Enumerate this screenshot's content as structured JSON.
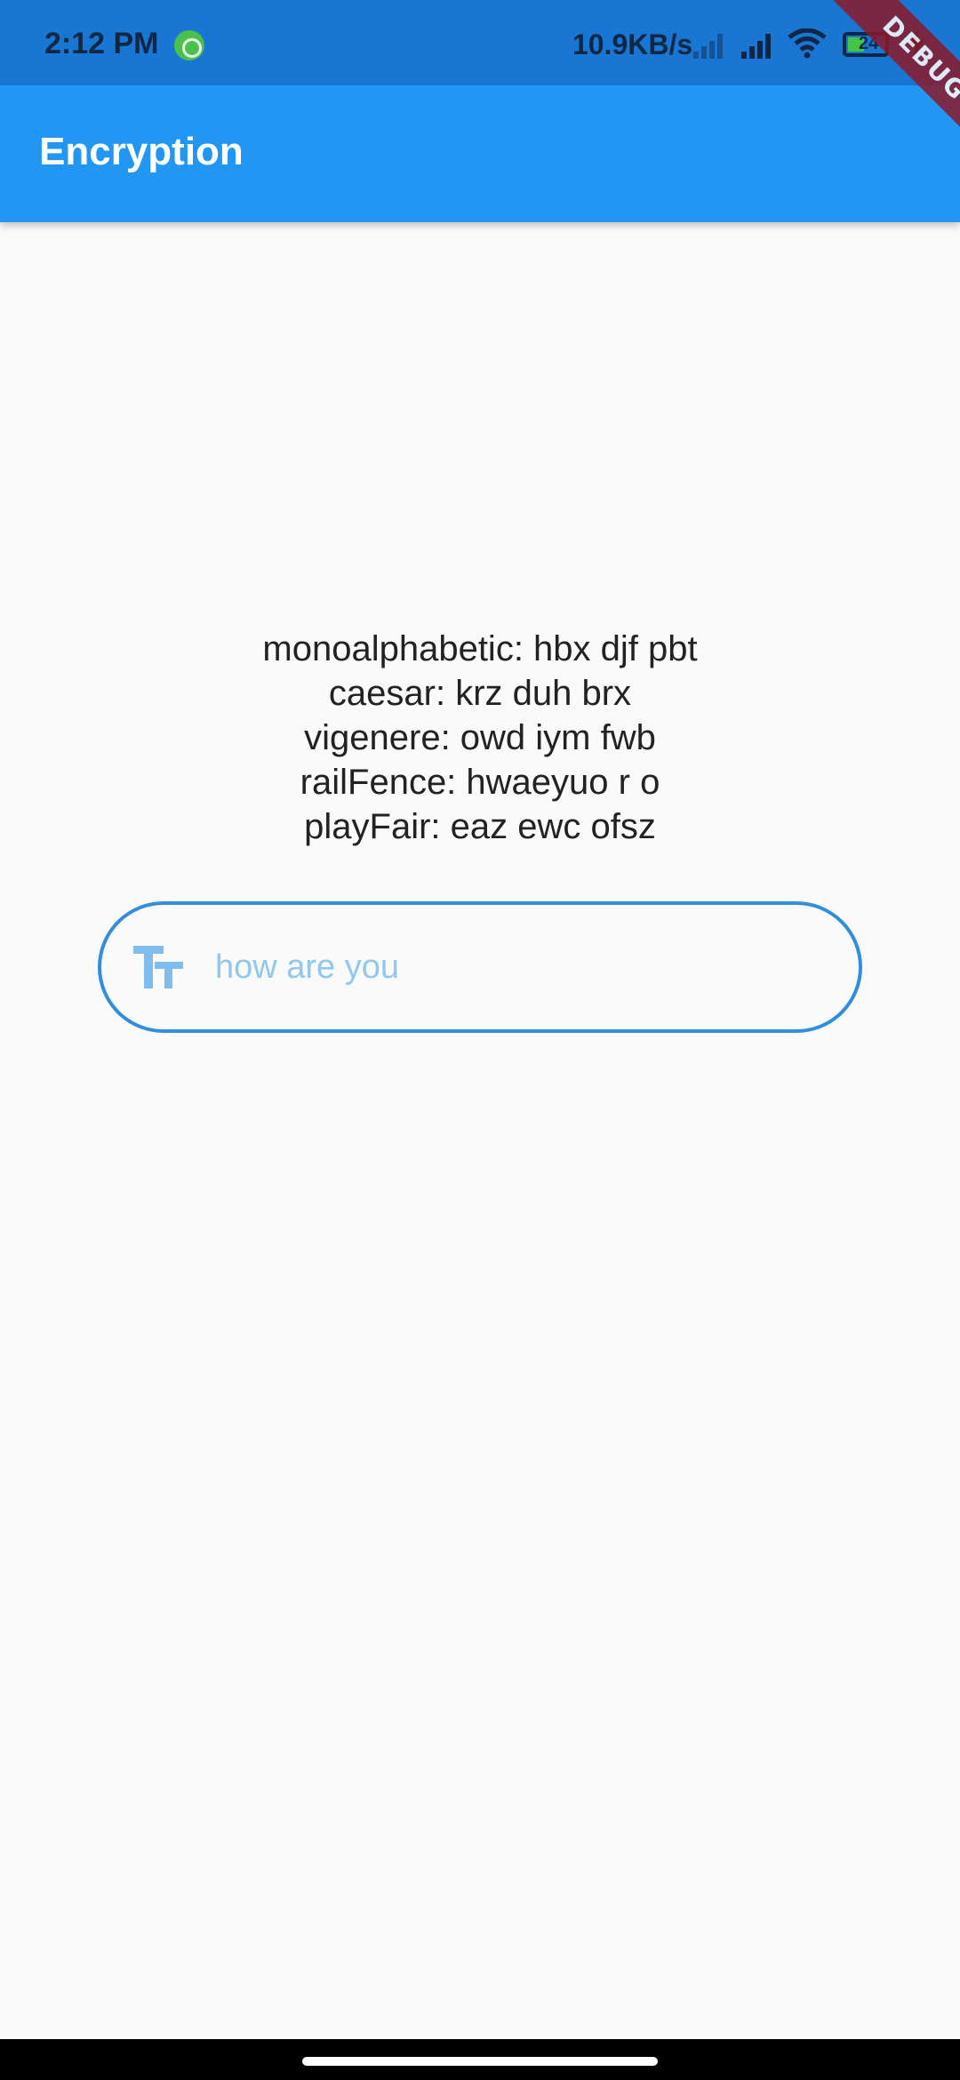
{
  "status_bar": {
    "time": "2:12 PM",
    "network_speed": "10.9KB/s",
    "battery_level": "24",
    "icons": [
      "app-notification-icon",
      "signal-icon",
      "signal-icon",
      "wifi-icon",
      "battery-icon",
      "charging-icon"
    ]
  },
  "debug_banner": "DEBUG",
  "app_bar": {
    "title": "Encryption"
  },
  "results": [
    "monoalphabetic: hbx djf pbt",
    "caesar: krz duh brx",
    "vigenere: owd iym fwb",
    "railFence: hwaeyuo r o",
    "playFair: eaz ewc ofsz"
  ],
  "input": {
    "placeholder": "how are you",
    "icon": "text-fields-icon"
  },
  "colors": {
    "primary": "#2196f3",
    "primary_dark": "#1976d2",
    "input_border": "#2f8ee0",
    "hint": "#90c8f0",
    "background": "#fafafa"
  }
}
